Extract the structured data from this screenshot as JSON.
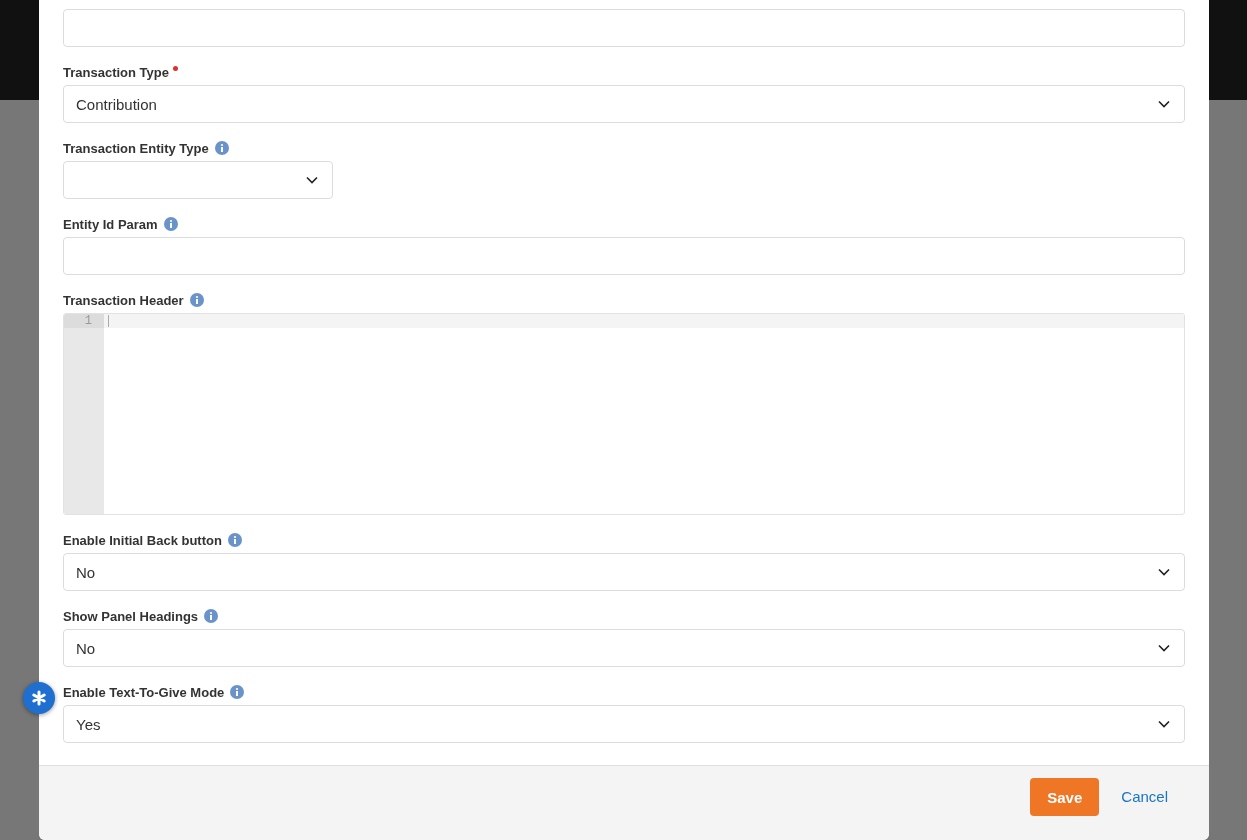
{
  "fields": [
    {
      "kind": "text"
    },
    {
      "kind": "select",
      "label": "Transaction Type",
      "value": "Contribution",
      "required": true
    },
    {
      "kind": "select",
      "label": "Transaction Entity Type",
      "info": true,
      "narrow": true
    },
    {
      "kind": "text",
      "label": "Entity Id Param",
      "info": true
    },
    {
      "kind": "code",
      "label": "Transaction Header",
      "line_numbers": [
        "1"
      ],
      "info": true
    },
    {
      "kind": "select",
      "label": "Enable Initial Back button",
      "value": "No",
      "info": true
    },
    {
      "kind": "select",
      "label": "Show Panel Headings",
      "value": "No",
      "info": true
    },
    {
      "kind": "select",
      "label": "Enable Text-To-Give Mode",
      "value": "Yes",
      "info": true
    }
  ],
  "footer": {
    "save": "Save",
    "cancel": "Cancel"
  }
}
